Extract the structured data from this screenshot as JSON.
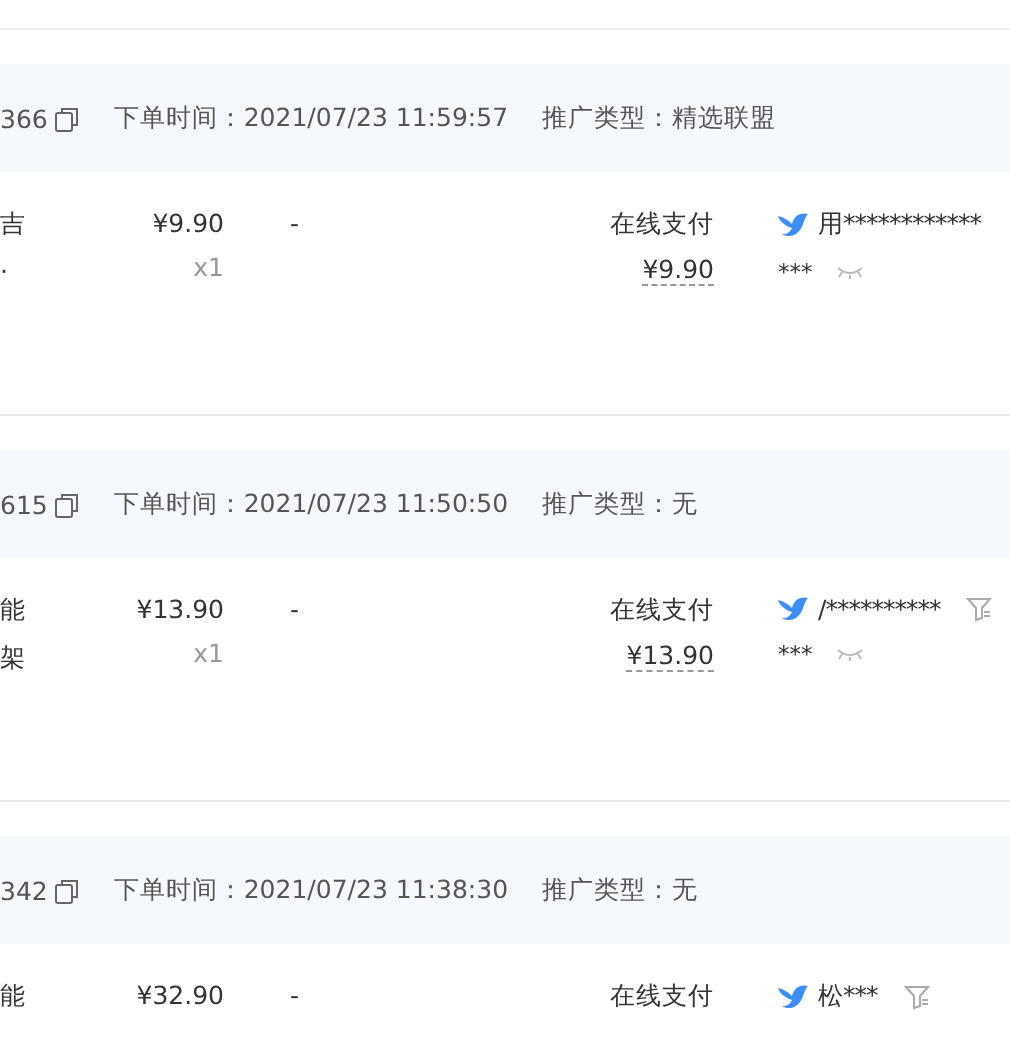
{
  "orders": [
    {
      "order_no": "366",
      "order_time": "下单时间：2021/07/23 11:59:57",
      "promotion": "推广类型：精选联盟",
      "product_lines": [
        "吉",
        "·"
      ],
      "price": "¥9.90",
      "quantity": "x1",
      "discount": "-",
      "payment": "在线支付",
      "amount": "¥9.90",
      "buyer": "用************",
      "buyer_sub": "***",
      "filter_icon": false,
      "eye_icon": true
    },
    {
      "order_no": "615",
      "order_time": "下单时间：2021/07/23 11:50:50",
      "promotion": "推广类型：无",
      "product_lines": [
        "能",
        "架"
      ],
      "price": "¥13.90",
      "quantity": "x1",
      "discount": "-",
      "payment": "在线支付",
      "amount": "¥13.90",
      "buyer": "/**********",
      "buyer_sub": "***",
      "filter_icon": true,
      "eye_icon": true
    },
    {
      "order_no": "342",
      "order_time": "下单时间：2021/07/23 11:38:30",
      "promotion": "推广类型：无",
      "product_lines": [
        "能"
      ],
      "price": "¥32.90",
      "discount": "-",
      "payment": "在线支付",
      "buyer": "松***",
      "filter_icon": true,
      "eye_icon": false
    }
  ]
}
